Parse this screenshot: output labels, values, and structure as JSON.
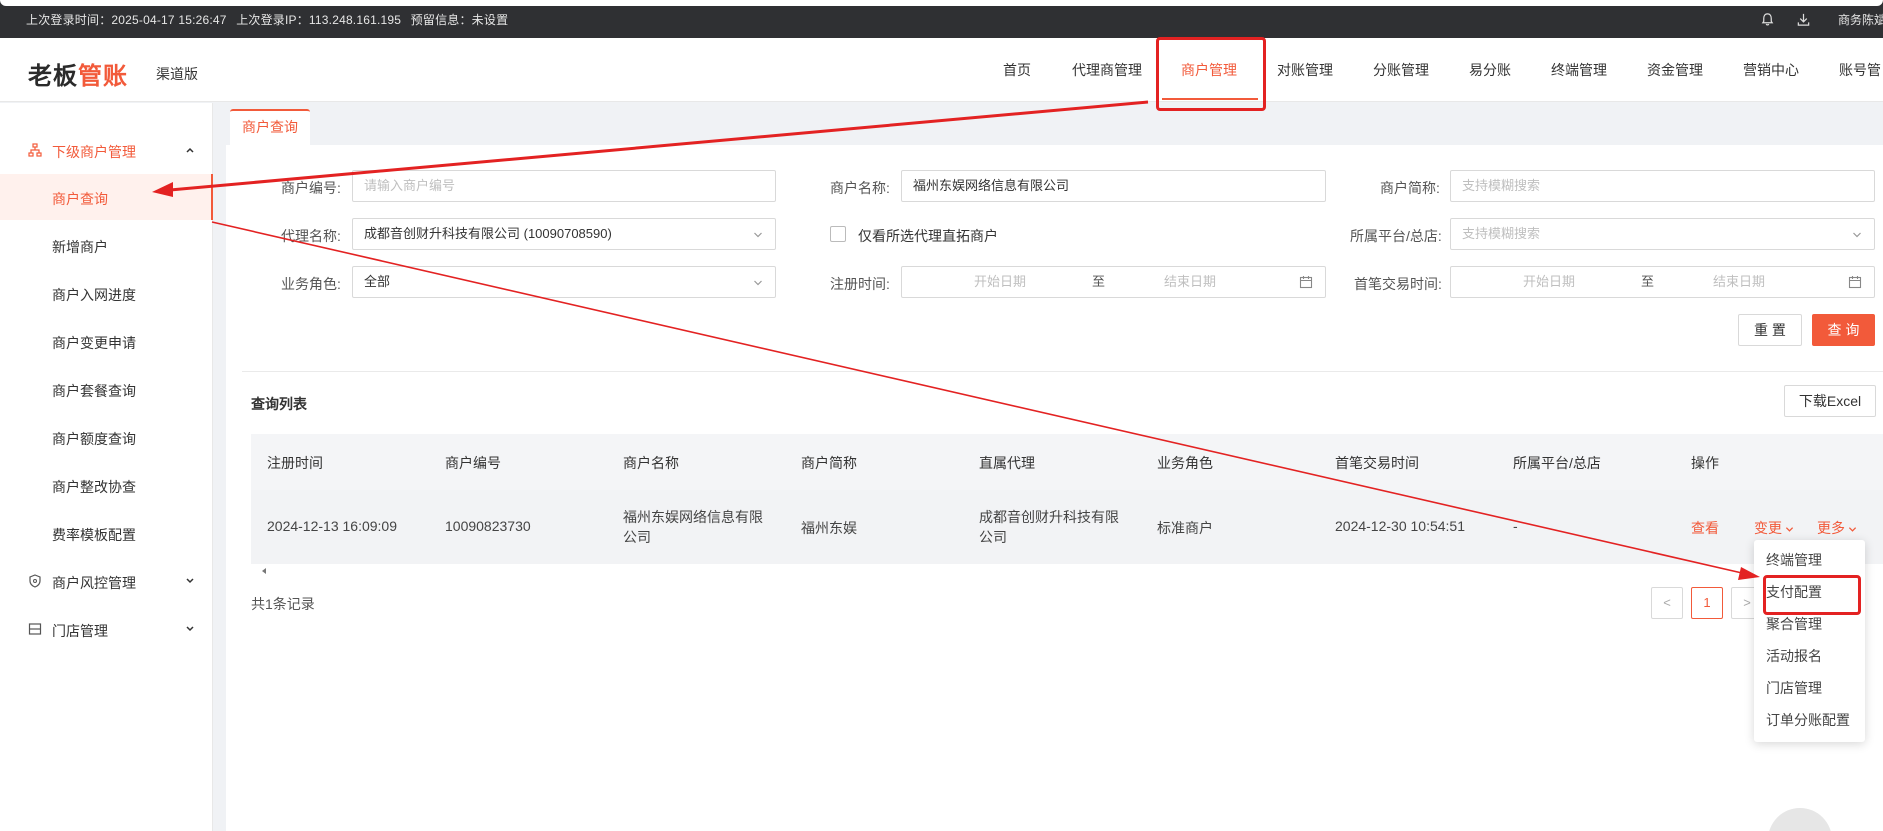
{
  "topbar": {
    "last_login_time": "上次登录时间：2025-04-17 15:26:47",
    "last_login_ip": "上次登录IP：113.248.161.195",
    "alert_info": "预留信息：未设置",
    "user_name": "商务陈斌"
  },
  "header": {
    "logo_text_black": "老板",
    "logo_text_accent": "管账",
    "logo_sub": "渠道版",
    "nav": [
      "首页",
      "代理商管理",
      "商户管理",
      "对账管理",
      "分账管理",
      "易分账",
      "终端管理",
      "资金管理",
      "营销中心",
      "账号管"
    ],
    "active_nav": "商户管理"
  },
  "sidebar": {
    "groups": [
      {
        "label": "下级商户管理",
        "icon": "org-tree-icon",
        "expanded": true,
        "items": [
          "商户查询",
          "新增商户",
          "商户入网进度",
          "商户变更申请",
          "商户套餐查询",
          "商户额度查询",
          "商户整改协查",
          "费率模板配置"
        ],
        "active_item": "商户查询"
      },
      {
        "label": "商户风控管理",
        "icon": "shield-icon",
        "expanded": false
      },
      {
        "label": "门店管理",
        "icon": "store-icon",
        "expanded": false
      }
    ]
  },
  "tabs": [
    "商户查询"
  ],
  "filters": {
    "merchant_no": {
      "label": "商户编号:",
      "placeholder": "请输入商户编号",
      "value": ""
    },
    "merchant_name": {
      "label": "商户名称:",
      "value": "福州东娱网络信息有限公司"
    },
    "merchant_short": {
      "label": "商户简称:",
      "placeholder": "支持模糊搜索",
      "value": ""
    },
    "agent_name": {
      "label": "代理名称:",
      "value": "成都音创财升科技有限公司 (10090708590)"
    },
    "only_direct": {
      "label": "仅看所选代理直拓商户",
      "checked": false
    },
    "platform": {
      "label": "所属平台/总店:",
      "placeholder": "支持模糊搜索",
      "value": ""
    },
    "business_role": {
      "label": "业务角色:",
      "value": "全部"
    },
    "register_time": {
      "label": "注册时间:",
      "start_placeholder": "开始日期",
      "sep": "至",
      "end_placeholder": "结束日期"
    },
    "first_trade_time": {
      "label": "首笔交易时间:",
      "start_placeholder": "开始日期",
      "sep": "至",
      "end_placeholder": "结束日期"
    },
    "reset_label": "重 置",
    "search_label": "查 询"
  },
  "list": {
    "title": "查询列表",
    "download_label": "下载Excel",
    "columns": [
      "注册时间",
      "商户编号",
      "商户名称",
      "商户简称",
      "直属代理",
      "业务角色",
      "首笔交易时间",
      "所属平台/总店",
      "操作"
    ],
    "rows": [
      {
        "register_time": "2024-12-13 16:09:09",
        "merchant_no": "10090823730",
        "merchant_name": "福州东娱网络信息有限公司",
        "merchant_short": "福州东娱",
        "agent": "成都音创财升科技有限公司",
        "role": "标准商户",
        "first_trade": "2024-12-30 10:54:51",
        "platform": "-",
        "actions": {
          "view": "查看",
          "change": "变更",
          "more": "更多"
        }
      }
    ],
    "total_text": "共1条记录",
    "pagination": {
      "prev": "<",
      "current": "1",
      "next": ">"
    }
  },
  "more_menu": {
    "items": [
      "终端管理",
      "支付配置",
      "聚合管理",
      "活动报名",
      "门店管理",
      "订单分账配置"
    ],
    "highlighted": "支付配置"
  },
  "annotations": {
    "color": "#e32222",
    "highlight_targets": [
      "商户管理",
      "支付配置"
    ],
    "arrow_targets": [
      "商户查询",
      "更多"
    ]
  },
  "colors": {
    "brand": "#f25a3a",
    "topbar_bg": "#2f3033",
    "annotation": "#e32222"
  }
}
